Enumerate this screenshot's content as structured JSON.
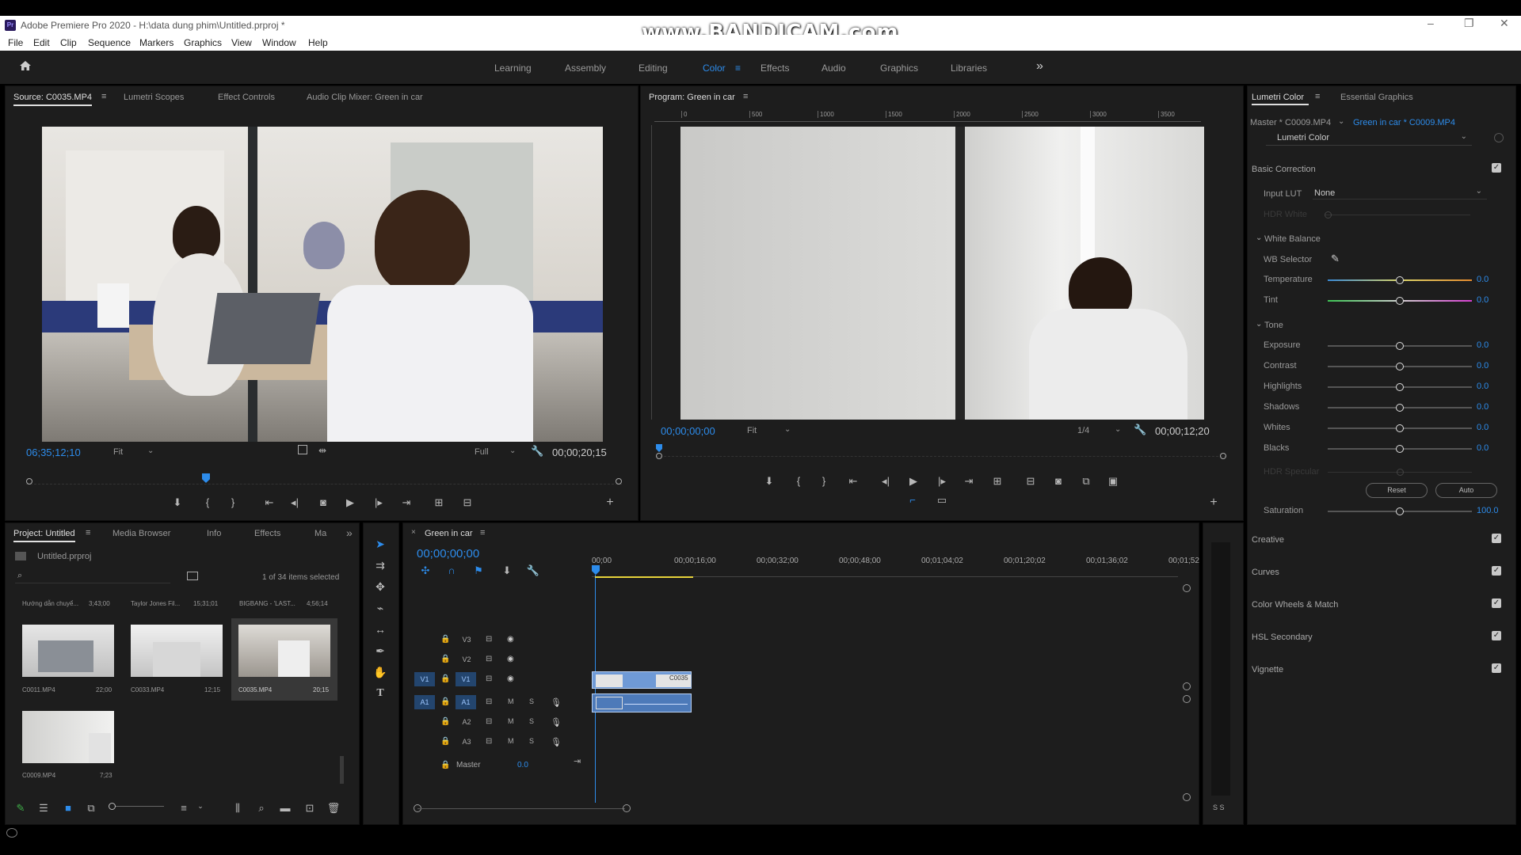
{
  "app": {
    "title": "Adobe Premiere Pro 2020 - H:\\data dung phim\\Untitled.prproj *",
    "icon_text": "Pr",
    "watermark": "www.BANDICAM.com"
  },
  "menu": [
    "File",
    "Edit",
    "Clip",
    "Sequence",
    "Markers",
    "Graphics",
    "View",
    "Window",
    "Help"
  ],
  "workspaces": {
    "items": [
      "Learning",
      "Assembly",
      "Editing",
      "Color",
      "Effects",
      "Audio",
      "Graphics",
      "Libraries"
    ],
    "active": "Color",
    "more": "»"
  },
  "source": {
    "tabs": [
      "Source: C0035.MP4",
      "Lumetri Scopes",
      "Effect Controls",
      "Audio Clip Mixer: Green in car"
    ],
    "timecode": "06;35;12;10",
    "fit": "Fit",
    "quality": "Full",
    "duration": "00;00;20;15",
    "playhead": 0.3
  },
  "program": {
    "tab": "Program: Green in car",
    "ruler": [
      "0",
      "500",
      "1000",
      "1500",
      "2000",
      "2500",
      "3000",
      "3500"
    ],
    "timecode": "00;00;00;00",
    "fit": "Fit",
    "quality": "1/4",
    "duration": "00;00;12;20"
  },
  "project": {
    "tabs": [
      "Project: Untitled",
      "Media Browser",
      "Info",
      "Effects",
      "Ma"
    ],
    "file": "Untitled.prproj",
    "selected": "1 of 34 items selected",
    "heads": [
      {
        "name": "Hướng dẫn chuyể...",
        "dur": "3;43;00"
      },
      {
        "name": "Taylor Jones Fil...",
        "dur": "15;31;01"
      },
      {
        "name": "BIGBANG - 'LAST...",
        "dur": "4;56;14"
      }
    ],
    "clips": [
      {
        "name": "C0011.MP4",
        "dur": "22;00"
      },
      {
        "name": "C0033.MP4",
        "dur": "12;15"
      },
      {
        "name": "C0035.MP4",
        "dur": "20;15"
      },
      {
        "name": "C0009.MP4",
        "dur": "7;23"
      }
    ]
  },
  "timeline": {
    "tab": "Green in car",
    "timecode": "00;00;00;00",
    "ruler": [
      "00;00",
      "00;00;16;00",
      "00;00;32;00",
      "00;00;48;00",
      "00;01;04;02",
      "00;01;20;02",
      "00;01;36;02",
      "00;01;52"
    ],
    "video_tracks": [
      "V3",
      "V2",
      "V1"
    ],
    "audio_tracks": [
      "A1",
      "A2",
      "A3"
    ],
    "source_patch": {
      "video": "V1",
      "audio": "A1"
    },
    "master": "Master",
    "master_val": "0.0",
    "clip_label": "C0035",
    "mute": "M",
    "solo": "S",
    "meter_label": "S S"
  },
  "lumetri": {
    "tabs": [
      "Lumetri Color",
      "Essential Graphics"
    ],
    "master_label": "Master * C0009.MP4",
    "sequence_label": "Green in car * C0009.MP4",
    "effect": "Lumetri Color",
    "basic": "Basic Correction",
    "input_lut": "Input LUT",
    "input_lut_val": "None",
    "hdr": "HDR White",
    "white_balance": "White Balance",
    "wb_selector": "WB Selector",
    "tone": "Tone",
    "sliders_wb": [
      {
        "label": "Temperature",
        "value": "0.0",
        "pos": 0.5
      },
      {
        "label": "Tint",
        "value": "0.0",
        "pos": 0.5
      }
    ],
    "sliders_tone": [
      {
        "label": "Exposure",
        "value": "0.0",
        "pos": 0.5
      },
      {
        "label": "Contrast",
        "value": "0.0",
        "pos": 0.5
      },
      {
        "label": "Highlights",
        "value": "0.0",
        "pos": 0.5
      },
      {
        "label": "Shadows",
        "value": "0.0",
        "pos": 0.5
      },
      {
        "label": "Whites",
        "value": "0.0",
        "pos": 0.5
      },
      {
        "label": "Blacks",
        "value": "0.0",
        "pos": 0.5
      }
    ],
    "hdr_specular": "HDR Specular",
    "reset": "Reset",
    "auto": "Auto",
    "saturation": {
      "label": "Saturation",
      "value": "100.0",
      "pos": 0.5
    },
    "sections": [
      "Creative",
      "Curves",
      "Color Wheels & Match",
      "HSL Secondary",
      "Vignette"
    ]
  },
  "colors": {
    "accent": "#2d8ceb",
    "panel": "#1d1d1d",
    "bg": "#000000"
  }
}
